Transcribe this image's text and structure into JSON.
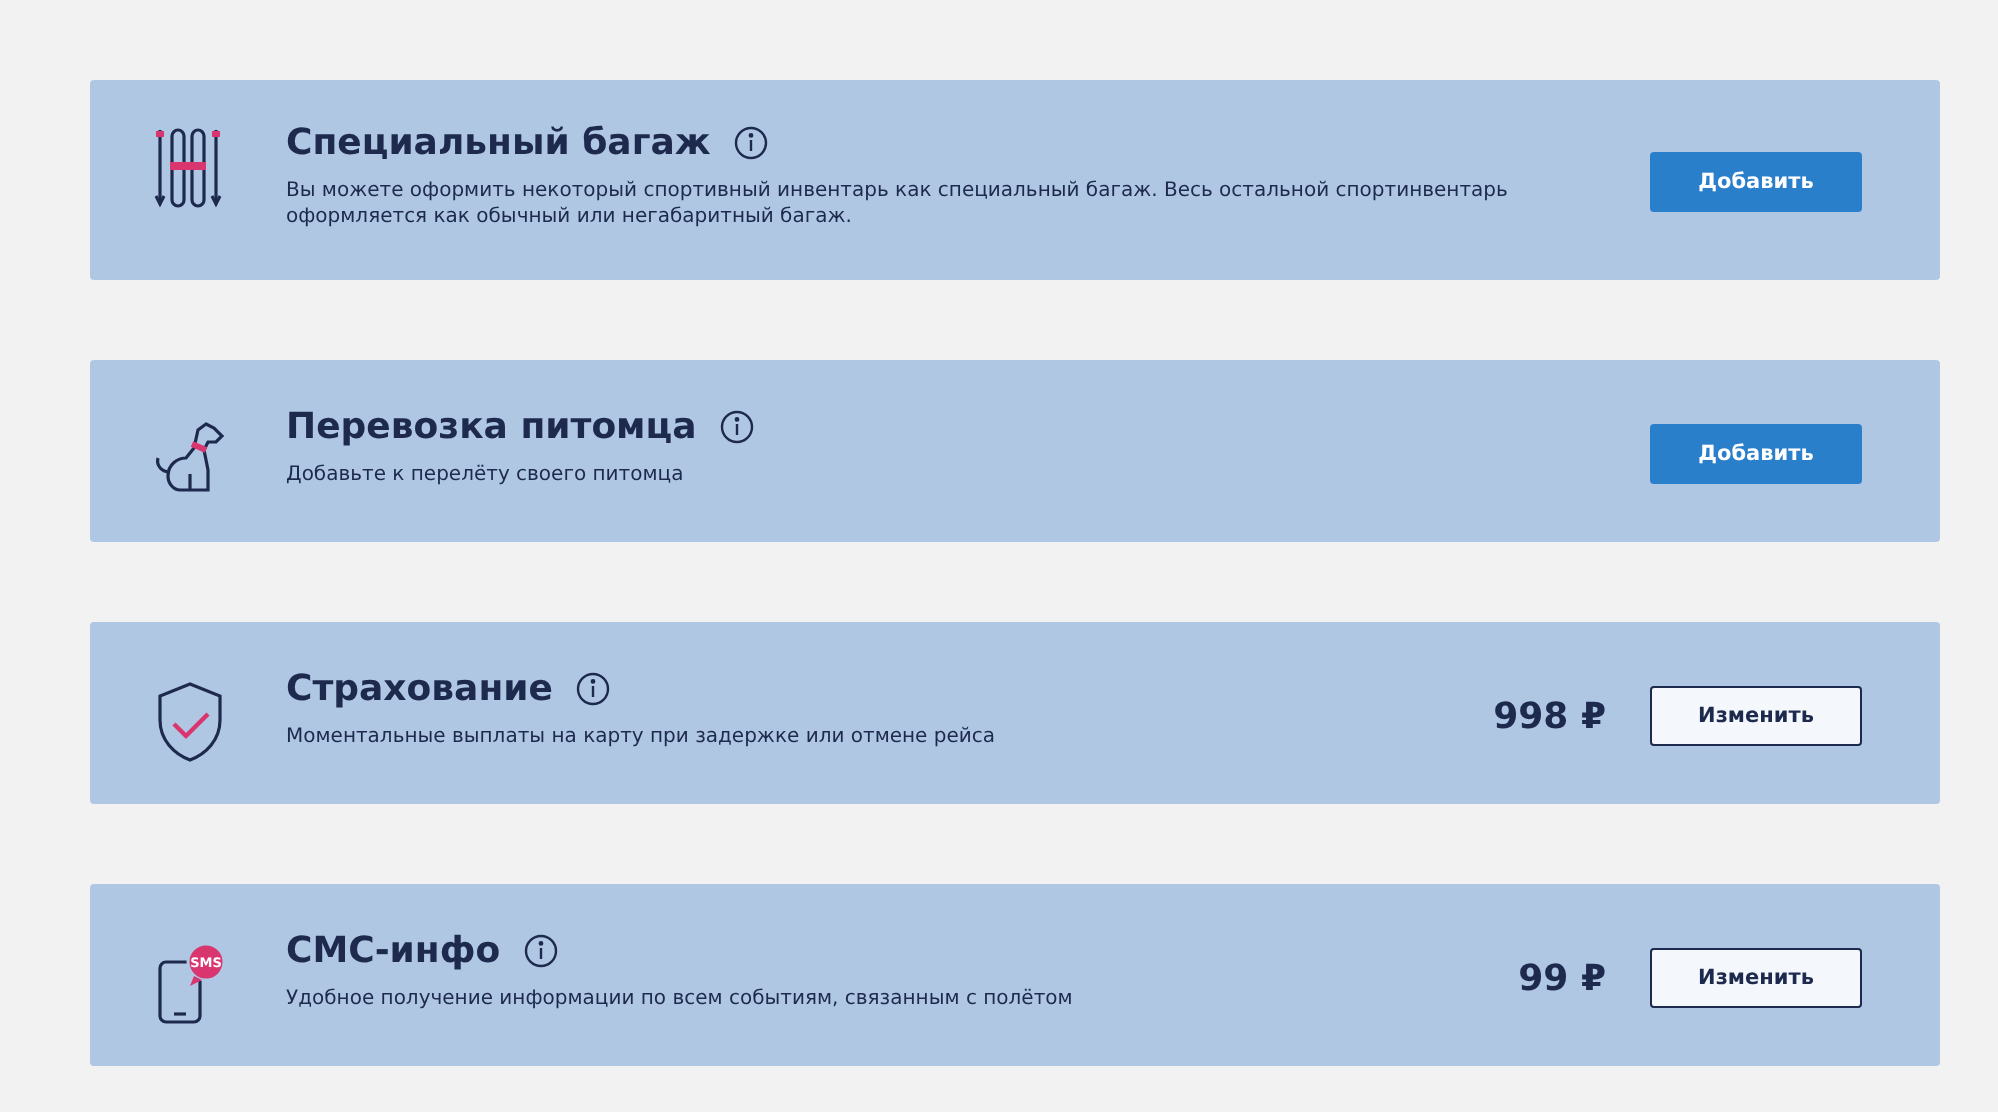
{
  "services": [
    {
      "kind": "skis",
      "title": "Специальный багаж",
      "description": "Вы можете оформить некоторый спортивный инвентарь как специальный багаж. Весь остальной спортинвентарь оформляется как обычный или негабаритный багаж.",
      "button": {
        "kind": "primary",
        "label": "Добавить"
      }
    },
    {
      "kind": "dog",
      "title": "Перевозка питомца",
      "description": "Добавьте к перелёту своего питомца",
      "button": {
        "kind": "primary",
        "label": "Добавить"
      }
    },
    {
      "kind": "shield",
      "title": "Страхование",
      "description": "Моментальные выплаты на карту при задержке или отмене рейса",
      "price": "998 ₽",
      "button": {
        "kind": "outline",
        "label": "Изменить"
      }
    },
    {
      "kind": "sms",
      "icon_text": "SMS",
      "title": "СМС-инфо",
      "description": "Удобное получение информации по всем событиям, связанным с полётом",
      "price": "99 ₽",
      "button": {
        "kind": "outline",
        "label": "Изменить"
      }
    }
  ]
}
